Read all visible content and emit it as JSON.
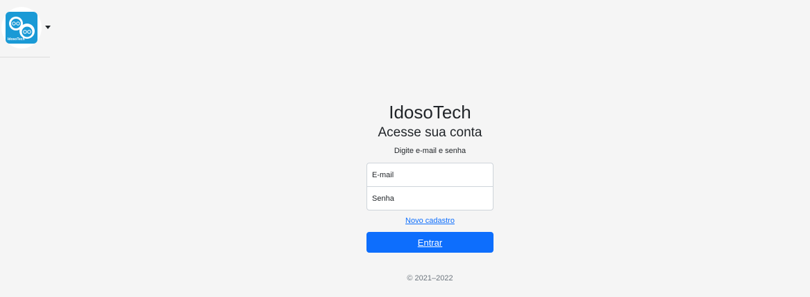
{
  "nav": {
    "logo_text": "IdosoTech",
    "logo_color": "#1a9ad6"
  },
  "login": {
    "brand": "IdosoTech",
    "subtitle": "Acesse sua conta",
    "instruction": "Digite e-mail e senha",
    "email_placeholder": "E-mail",
    "password_placeholder": "Senha",
    "register_link": "Novo cadastro",
    "submit_label": "Entrar",
    "primary_color": "#0d6efd"
  },
  "footer": {
    "copyright": "© 2021–2022"
  }
}
